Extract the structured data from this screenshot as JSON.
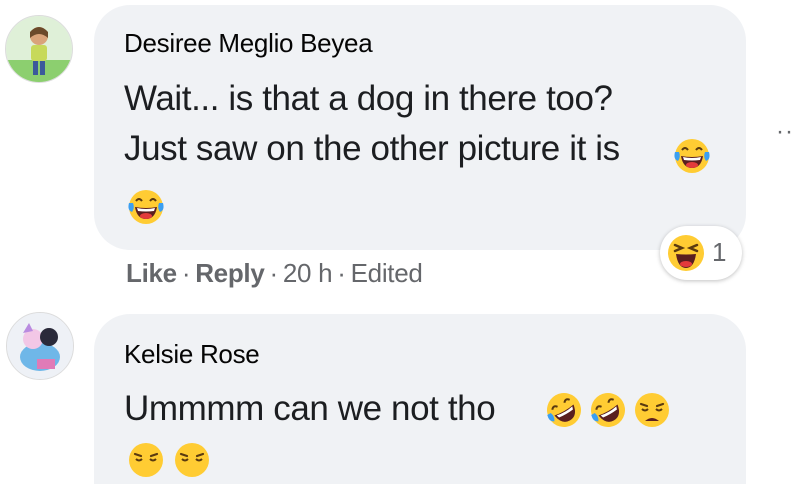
{
  "comments": [
    {
      "author": "Desiree Meglio Beyea",
      "lines": [
        "Wait... is that a dog in there too?",
        "Just saw on the other picture it is"
      ],
      "reaction_count": "1",
      "actions": {
        "like": "Like",
        "reply": "Reply",
        "time": "20 h",
        "edited": "Edited",
        "separator": "·"
      },
      "more_menu": "··"
    },
    {
      "author": "Kelsie Rose",
      "lines": [
        "Ummmm can we not tho"
      ]
    }
  ],
  "icons": {
    "laugh": "face-with-tears-of-joy",
    "rofl": "rolling-on-floor-laughing",
    "weary": "weary-face",
    "haha_reaction": "haha-reaction"
  },
  "colors": {
    "bubble": "#f0f2f5",
    "secondary_text": "#65676b",
    "emoji_yellow": "#ffcc33",
    "emoji_mouth": "#e33b3b",
    "emoji_tear": "#3b9ff1"
  }
}
